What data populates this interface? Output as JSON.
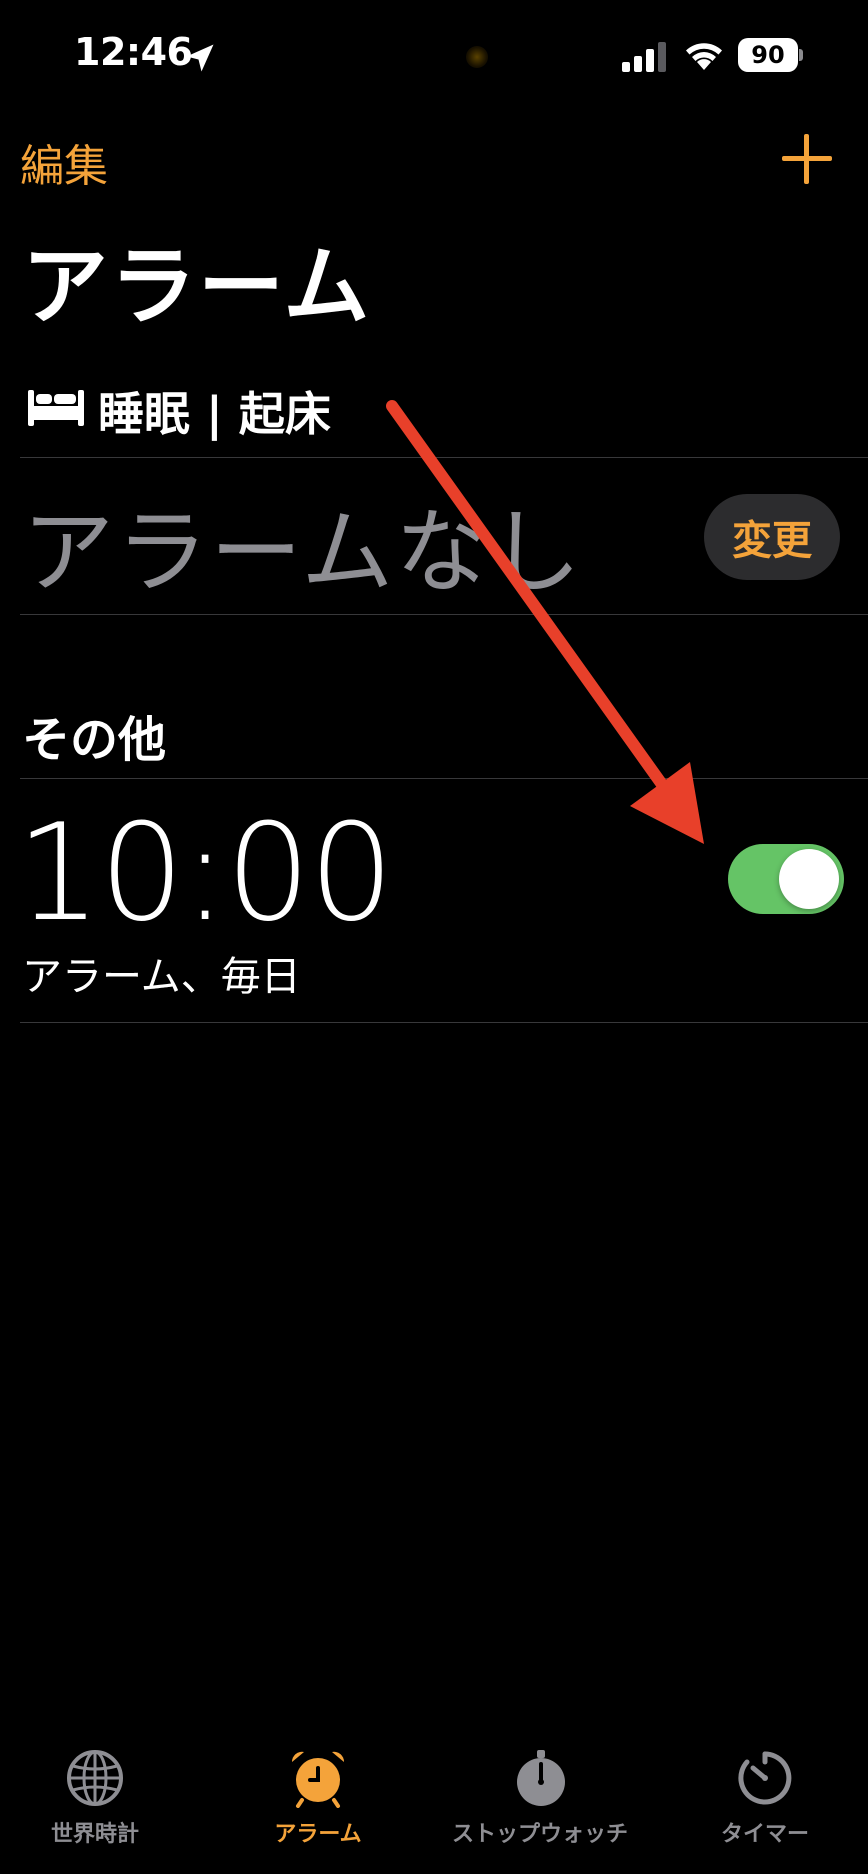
{
  "status_bar": {
    "time": "12:46",
    "battery": "90",
    "location_icon": "location-arrow-icon",
    "signal_icon": "cellular-signal-icon",
    "wifi_icon": "wifi-icon"
  },
  "nav": {
    "edit_label": "編集",
    "add_icon": "plus-icon"
  },
  "page_title": "アラーム",
  "sleep": {
    "header": "睡眠 | 起床",
    "no_alarm": "アラームなし",
    "change_label": "変更"
  },
  "other": {
    "header": "その他",
    "alarm": {
      "time": "10:00",
      "label": "アラーム、毎日",
      "enabled": true
    }
  },
  "tabs": [
    {
      "label": "世界時計",
      "icon": "globe-icon",
      "active": false
    },
    {
      "label": "アラーム",
      "icon": "alarm-clock-icon",
      "active": true
    },
    {
      "label": "ストップウォッチ",
      "icon": "stopwatch-icon",
      "active": false
    },
    {
      "label": "タイマー",
      "icon": "timer-icon",
      "active": false
    }
  ],
  "colors": {
    "accent": "#f4a33a",
    "toggle_on": "#65c466",
    "annotation_arrow": "#e8402a",
    "background": "#000000"
  }
}
